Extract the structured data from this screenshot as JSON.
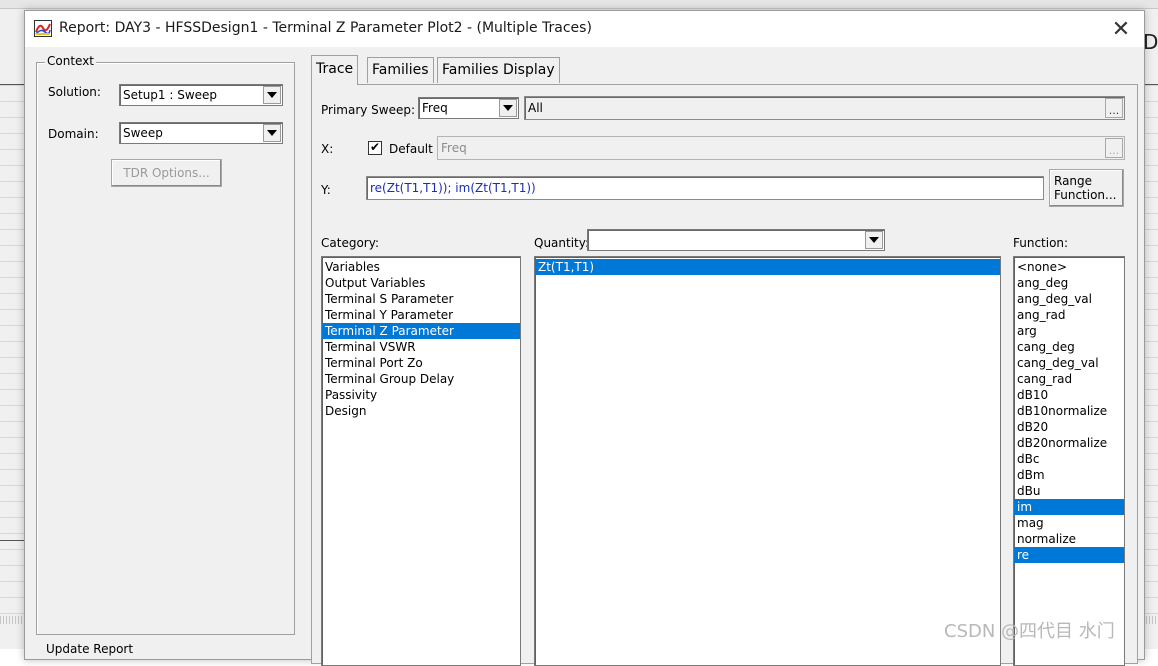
{
  "window": {
    "title": "Report: DAY3 - HFSSDesign1 - Terminal Z Parameter Plot2 - (Multiple Traces)",
    "close_icon": "close-icon",
    "app_icon": "report-plot-icon"
  },
  "background": {
    "right_letter": "De"
  },
  "context": {
    "group_label": "Context",
    "solution_label": "Solution:",
    "solution_value": "Setup1 : Sweep",
    "domain_label": "Domain:",
    "domain_value": "Sweep",
    "tdr_button": "TDR Options..."
  },
  "tabs": [
    {
      "label": "Trace",
      "active": true
    },
    {
      "label": "Families",
      "active": false
    },
    {
      "label": "Families Display",
      "active": false
    }
  ],
  "trace": {
    "primary_sweep_label": "Primary Sweep:",
    "primary_sweep_value": "Freq",
    "primary_sweep_range": "All",
    "ellipsis": "...",
    "x_label": "X:",
    "default_checkbox_label": "Default",
    "default_checked": true,
    "x_value": "Freq",
    "y_label": "Y:",
    "y_value": "re(Zt(T1,T1)); im(Zt(T1,T1))",
    "range_function_line1": "Range",
    "range_function_line2": "Function..."
  },
  "category": {
    "label": "Category:",
    "items": [
      "Variables",
      "Output Variables",
      "Terminal S Parameter",
      "Terminal Y Parameter",
      "Terminal Z Parameter",
      "Terminal VSWR",
      "Terminal Port Zo",
      "Terminal Group Delay",
      "Passivity",
      "Design"
    ],
    "selected_index": 4
  },
  "quantity": {
    "label": "Quantity:",
    "filter_value": "",
    "items": [
      "Zt(T1,T1)"
    ],
    "selected_index": 0
  },
  "function": {
    "label": "Function:",
    "items": [
      "<none>",
      "ang_deg",
      "ang_deg_val",
      "ang_rad",
      "arg",
      "cang_deg",
      "cang_deg_val",
      "cang_rad",
      "dB10",
      "dB10normalize",
      "dB20",
      "dB20normalize",
      "dBc",
      "dBm",
      "dBu",
      "im",
      "mag",
      "normalize",
      "re"
    ],
    "selected": [
      "im",
      "re"
    ]
  },
  "bottom": {
    "update_report_label": "Update Report"
  },
  "watermark": "CSDN @四代目 水门",
  "colors": {
    "selection": "#0078d7",
    "y_text": "#1a2fb8",
    "dialog_bg": "#f0f0f0"
  }
}
